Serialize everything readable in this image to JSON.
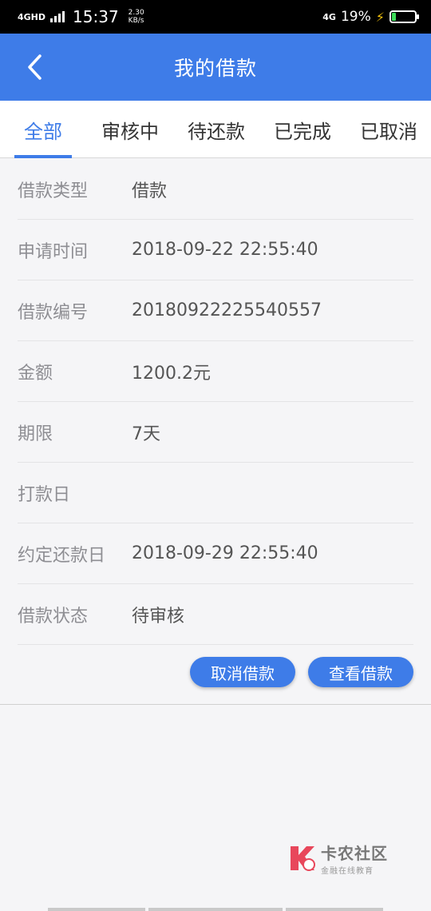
{
  "status_bar": {
    "network": "4GHD",
    "time": "15:37",
    "speed_value": "2.30",
    "speed_unit": "KB/s",
    "network_right": "4G",
    "battery_percent": "19%",
    "battery_level": 0.19
  },
  "header": {
    "title": "我的借款"
  },
  "tabs": [
    {
      "label": "全部",
      "active": true
    },
    {
      "label": "审核中",
      "active": false
    },
    {
      "label": "待还款",
      "active": false
    },
    {
      "label": "已完成",
      "active": false
    },
    {
      "label": "已取消",
      "active": false
    }
  ],
  "loan": {
    "rows": [
      {
        "label": "借款类型",
        "value": "借款"
      },
      {
        "label": "申请时间",
        "value": "2018-09-22 22:55:40"
      },
      {
        "label": "借款编号",
        "value": "20180922225540557"
      },
      {
        "label": "金额",
        "value": "1200.2元"
      },
      {
        "label": "期限",
        "value": "7天"
      },
      {
        "label": "打款日",
        "value": ""
      },
      {
        "label": "约定还款日",
        "value": "2018-09-29 22:55:40"
      },
      {
        "label": "借款状态",
        "value": "待审核"
      }
    ],
    "cancel_label": "取消借款",
    "view_label": "查看借款"
  },
  "watermark": {
    "title": "卡农社区",
    "subtitle": "金融在线教育"
  },
  "colors": {
    "primary": "#3e7ce8",
    "background": "#f5f5f7",
    "label_gray": "#8e8e93"
  }
}
